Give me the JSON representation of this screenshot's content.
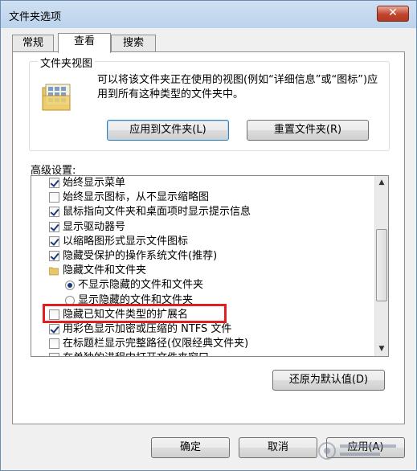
{
  "window": {
    "title": "文件夹选项",
    "close_label": "✕"
  },
  "tabs": [
    {
      "label": "常规"
    },
    {
      "label": "查看"
    },
    {
      "label": "搜索"
    }
  ],
  "folder_views": {
    "legend": "文件夹视图",
    "description": "可以将该文件夹正在使用的视图(例如“详细信息”或“图标”)应用到所有这种类型的文件夹中。",
    "apply_button": "应用到文件夹(L)",
    "reset_button": "重置文件夹(R)"
  },
  "advanced": {
    "label": "高级设置:",
    "items": [
      {
        "type": "checkbox",
        "checked": true,
        "label": "始终显示菜单"
      },
      {
        "type": "checkbox",
        "checked": false,
        "label": "始终显示图标，从不显示缩略图"
      },
      {
        "type": "checkbox",
        "checked": true,
        "label": "鼠标指向文件夹和桌面项时显示提示信息"
      },
      {
        "type": "checkbox",
        "checked": true,
        "label": "显示驱动器号"
      },
      {
        "type": "checkbox",
        "checked": true,
        "label": "以缩略图形式显示文件图标"
      },
      {
        "type": "checkbox",
        "checked": true,
        "label": "隐藏受保护的操作系统文件(推荐)"
      },
      {
        "type": "folder",
        "checked": false,
        "label": "隐藏文件和文件夹"
      },
      {
        "type": "radio",
        "checked": true,
        "label": "不显示隐藏的文件和文件夹"
      },
      {
        "type": "radio",
        "checked": false,
        "label": "显示隐藏的文件和文件夹"
      },
      {
        "type": "checkbox",
        "checked": false,
        "label": "隐藏已知文件类型的扩展名"
      },
      {
        "type": "checkbox",
        "checked": true,
        "label": "用彩色显示加密或压缩的 NTFS 文件"
      },
      {
        "type": "checkbox",
        "checked": false,
        "label": "在标题栏显示完整路径(仅限经典文件夹)"
      },
      {
        "type": "checkbox",
        "checked": false,
        "label": "在单独的进程中打开文件夹窗口"
      }
    ],
    "restore_button": "还原为默认值(D)"
  },
  "footer": {
    "ok": "确定",
    "cancel": "取消",
    "apply": "应用(A)"
  },
  "colors": {
    "highlight": "#e02020",
    "accent": "#1a3a7a"
  }
}
